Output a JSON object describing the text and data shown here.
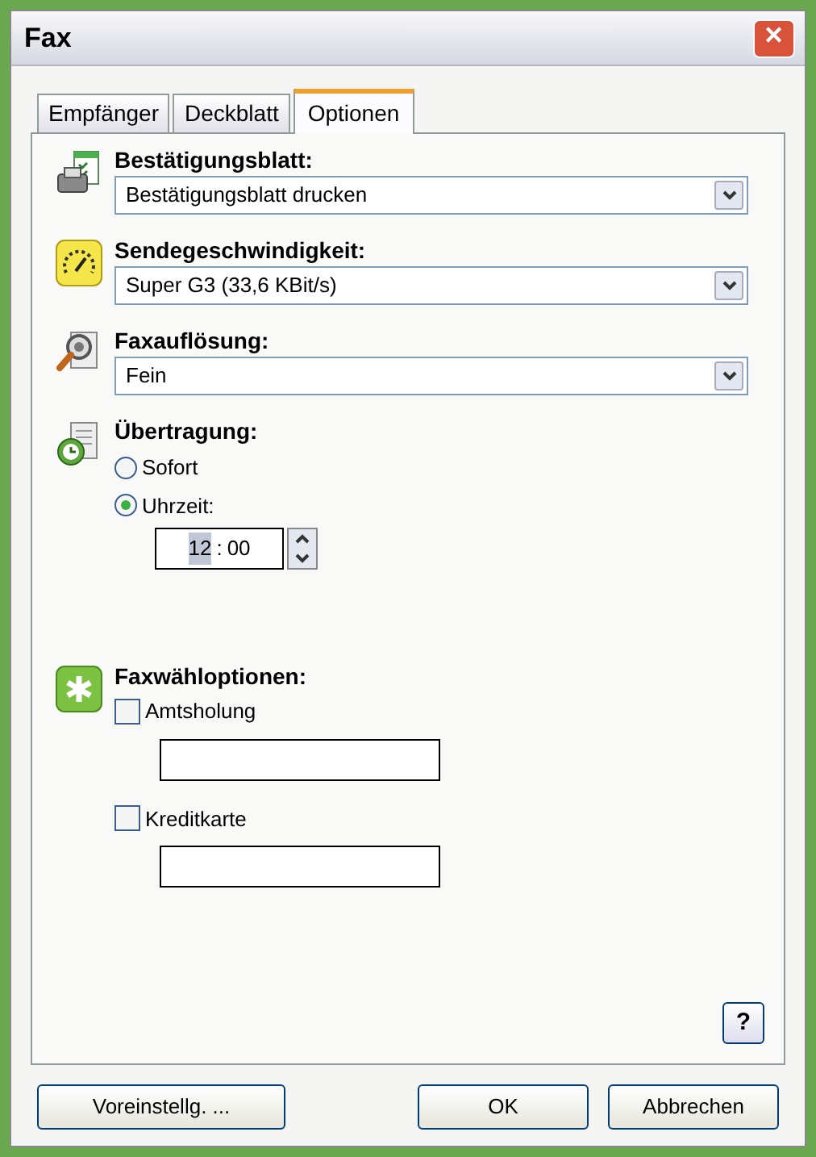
{
  "window": {
    "title": "Fax",
    "close": "✕"
  },
  "tabs": [
    {
      "label": "Empfänger",
      "selected": false
    },
    {
      "label": "Deckblatt",
      "selected": false
    },
    {
      "label": "Optionen",
      "selected": true
    }
  ],
  "sections": [
    {
      "kind": "select",
      "label": "Bestätigungsblatt:",
      "value": "Bestätigungsblatt drucken"
    },
    {
      "kind": "select",
      "label": "Sendegeschwindigkeit:",
      "value": "Super G3 (33,6 KBit/s)"
    },
    {
      "kind": "select",
      "label": "Faxauflösung:",
      "value": "Fein"
    },
    {
      "kind": "radios",
      "label": "Übertragung:",
      "options": [
        {
          "label": "Sofort",
          "selected": false
        },
        {
          "label": "Uhrzeit:",
          "selected": true
        }
      ],
      "time": {
        "hours": "12",
        "separator": ":",
        "minutes": "00"
      }
    },
    {
      "kind": "checks",
      "label": "Faxwähloptionen:",
      "options": [
        {
          "label": "Amtsholung",
          "checked": false
        },
        {
          "label": "Kreditkarte",
          "checked": false
        }
      ]
    }
  ],
  "help": "?",
  "buttons": [
    {
      "label": "Voreinstellg. ...",
      "kind": "left"
    },
    {
      "label": "OK",
      "kind": "right"
    },
    {
      "label": "Abbrechen",
      "kind": "right"
    }
  ]
}
